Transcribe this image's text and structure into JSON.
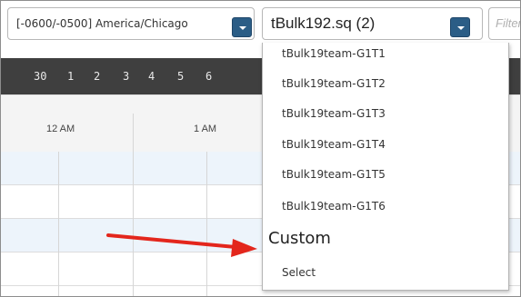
{
  "filters": {
    "timezone_value": "[-0600/-0500] America/Chicago",
    "team_value": "tBulk192.sq (2)",
    "filter_placeholder": "Filter"
  },
  "calendar": {
    "days": [
      "30",
      "1",
      "2",
      "3",
      "4",
      "5",
      "6"
    ],
    "hours": [
      "12 AM",
      "1 AM"
    ]
  },
  "dropdown": {
    "options": [
      "tBulk19team-G1T1",
      "tBulk19team-G1T2",
      "tBulk19team-G1T3",
      "tBulk19team-G1T4",
      "tBulk19team-G1T5",
      "tBulk19team-G1T6"
    ],
    "group_label": "Custom",
    "custom_options": [
      "Select"
    ]
  },
  "colors": {
    "dropdown_button": "#2b5d86",
    "day_strip": "#3f3f3f",
    "annotation_arrow": "#e3261c",
    "row_alt": "#edf4fb"
  }
}
